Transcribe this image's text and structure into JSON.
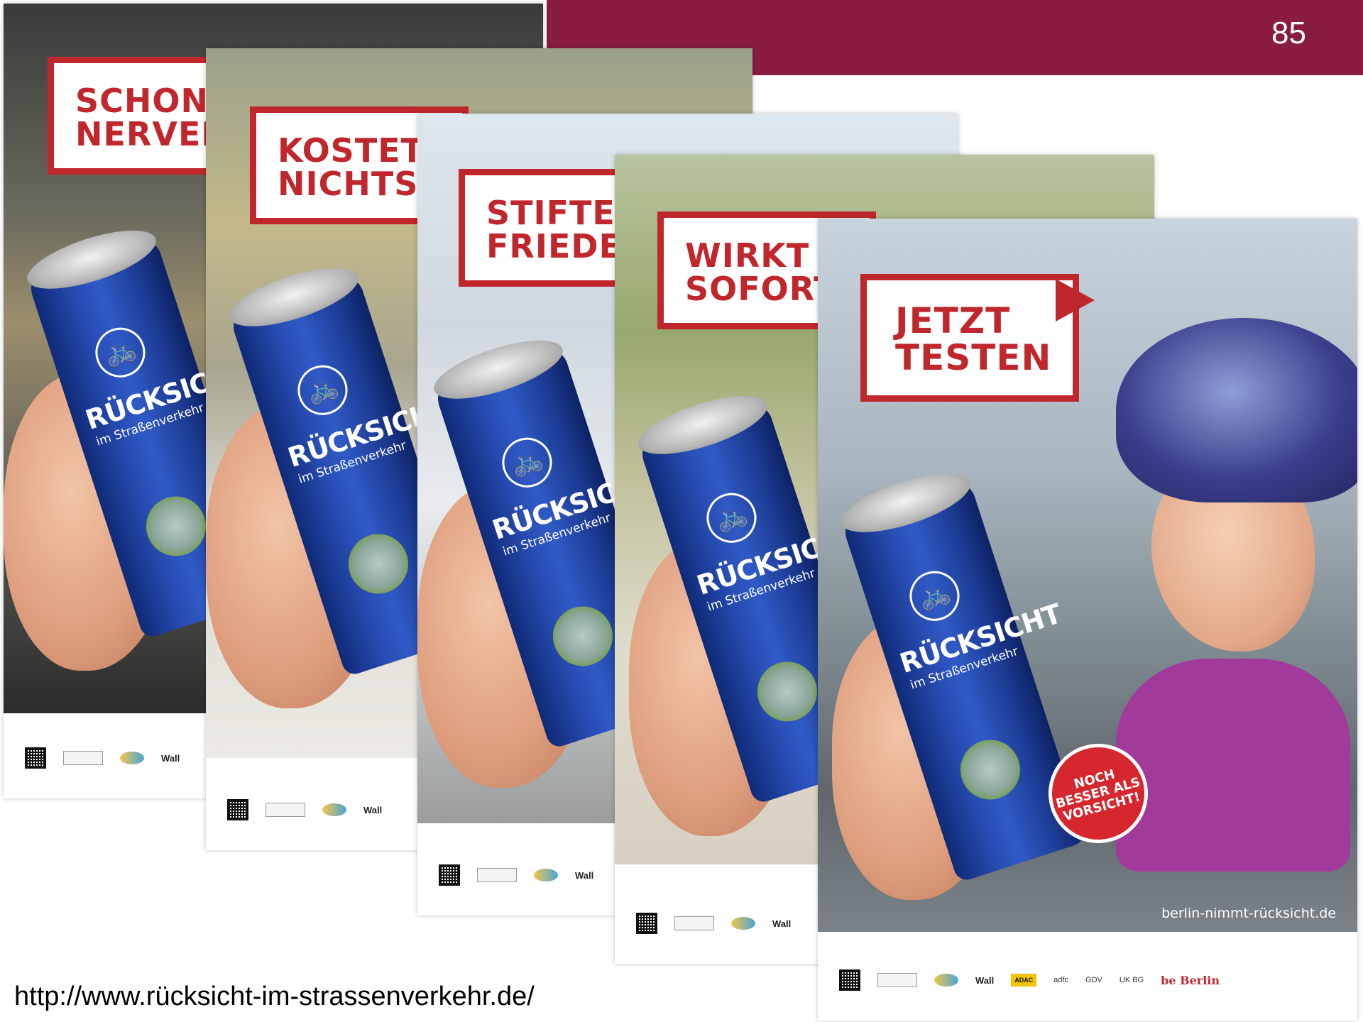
{
  "slide": {
    "page_number": "85"
  },
  "posters": [
    {
      "callout": [
        "SCHONT",
        "NERVEN"
      ],
      "can_brand": "RÜCKSICHT",
      "can_sub": "im Straßenverkehr"
    },
    {
      "callout": [
        "KOSTET",
        "NICHTS"
      ],
      "can_brand": "RÜCKSICHT",
      "can_sub": "im Straßenverkehr"
    },
    {
      "callout": [
        "STIFTET",
        "FRIEDEN"
      ],
      "can_brand": "RÜCKSICHT",
      "can_sub": "im Straßenverkehr"
    },
    {
      "callout": [
        "WIRKT",
        "SOFORT"
      ],
      "can_brand": "RÜCKSICHT",
      "can_sub": "im Straßenverkehr"
    },
    {
      "callout": [
        "JETZT",
        "TESTEN"
      ],
      "can_brand": "RÜCKSICHT",
      "can_sub": "im Straßenverkehr",
      "badge": "NOCH BESSER ALS VORSICHT!",
      "poster_url": "berlin-nimmt-rücksicht.de"
    }
  ],
  "logos": {
    "wall": "Wall",
    "adfc": "adfc",
    "gdv": "GDV",
    "ukbg": "UK BG",
    "adac": "ADAC",
    "berlin": "be Berlin"
  },
  "footer": {
    "url": "http://www.rücksicht-im-strassenverkehr.de/"
  },
  "icons": {
    "can_icon": "bicycle-icon",
    "qr": "qr-code-icon"
  },
  "colors": {
    "header_bar": "#8a1c42",
    "callout_red": "#c0272d",
    "can_blue": "#2a50b8"
  }
}
